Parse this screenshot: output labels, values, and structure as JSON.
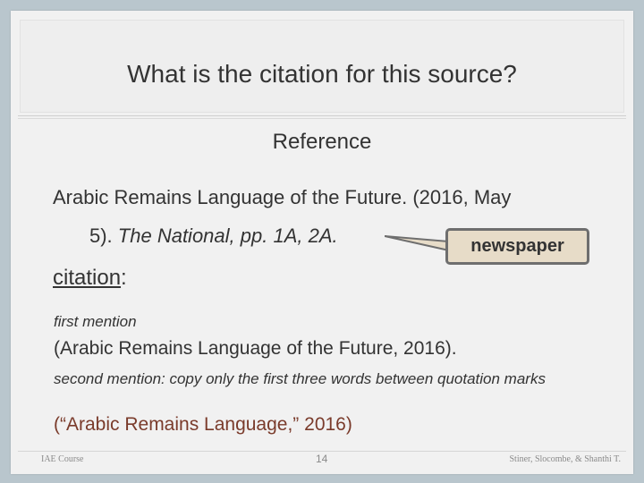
{
  "slide": {
    "title": "What is the citation for this source?",
    "reference_heading": "Reference",
    "reference_line1": "Arabic Remains Language of the Future. (2016, May",
    "reference_line2_prefix": "5). ",
    "reference_line2_italic": "The National, pp. 1A, 2A.",
    "callout_label": "newspaper",
    "citation_label": "citation",
    "citation_colon": ":",
    "first_mention_label": "first mention",
    "first_mention_text": "(Arabic Remains Language of the Future, 2016).",
    "second_mention_label": "second mention: copy only the first three words between quotation marks",
    "second_mention_text": "(“Arabic Remains Language,” 2016)"
  },
  "footer": {
    "left": "IAE Course",
    "page_number": "14",
    "right": "Stiner, Slocombe, & Shanthi T."
  },
  "colors": {
    "background": "#b9c6cd",
    "slide": "#f1f1f1",
    "callout_fill": "#e7dcc8",
    "callout_border": "#6e6e6e",
    "second_text": "#7a3b2b"
  }
}
